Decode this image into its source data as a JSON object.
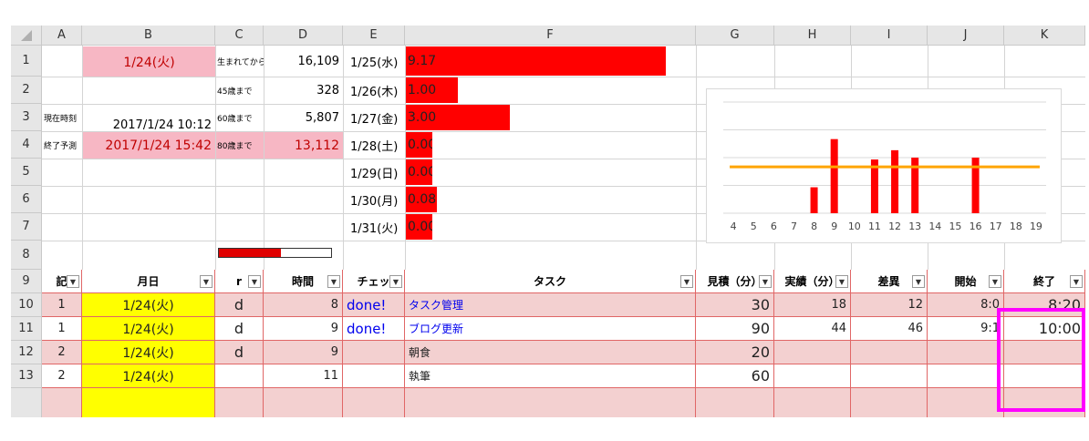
{
  "columns": [
    "A",
    "B",
    "C",
    "D",
    "E",
    "F",
    "G",
    "H",
    "I",
    "J",
    "K"
  ],
  "rows": [
    "1",
    "2",
    "3",
    "4",
    "5",
    "6",
    "7",
    "8",
    "9",
    "10",
    "11",
    "12",
    "13"
  ],
  "top": {
    "b1": "1/24(火)",
    "a3": "現在時刻",
    "b3": "2017/1/24 10:12",
    "a4": "終了予測",
    "b4": "2017/1/24 15:42",
    "c1": "生まれてから",
    "d1": "16,109",
    "c2": "45歳まで",
    "d2": "328",
    "c3": "60歳まで",
    "d3": "5,807",
    "c4": "80歳まで",
    "d4": "13,112",
    "progress": 0.55
  },
  "days": [
    {
      "date": "1/25(水)",
      "value": "9.17",
      "fill": 1.0
    },
    {
      "date": "1/26(木)",
      "value": "1.00",
      "fill": 0.2
    },
    {
      "date": "1/27(金)",
      "value": "3.00",
      "fill": 0.4
    },
    {
      "date": "1/28(土)",
      "value": "0.00",
      "fill": 0.1
    },
    {
      "date": "1/29(日)",
      "value": "0.00",
      "fill": 0.1
    },
    {
      "date": "1/30(月)",
      "value": "0.08",
      "fill": 0.12
    },
    {
      "date": "1/31(火)",
      "value": "0.00",
      "fill": 0.1
    }
  ],
  "table_headers": {
    "a": "記",
    "b": "月日",
    "c": "r",
    "d": "時間",
    "e": "チェッ",
    "f": "タスク",
    "g": "見積（分）",
    "h": "実績（分）",
    "i": "差異",
    "j": "開始",
    "k": "終了"
  },
  "table_rows": [
    {
      "a": "1",
      "b": "1/24(火)",
      "c": "d",
      "d": "8",
      "e": "done!",
      "f": "タスク管理",
      "g": "30",
      "h": "18",
      "i": "12",
      "j": "8:0",
      "k": "8:20"
    },
    {
      "a": "1",
      "b": "1/24(火)",
      "c": "d",
      "d": "9",
      "e": "done!",
      "f": "ブログ更新",
      "g": "90",
      "h": "44",
      "i": "46",
      "j": "9:1",
      "k": "10:00"
    },
    {
      "a": "2",
      "b": "1/24(火)",
      "c": "d",
      "d": "9",
      "e": "",
      "f": "朝食",
      "g": "20",
      "h": "",
      "i": "",
      "j": "",
      "k": ""
    },
    {
      "a": "2",
      "b": "1/24(火)",
      "c": "",
      "d": "11",
      "e": "",
      "f": "執筆",
      "g": "60",
      "h": "",
      "i": "",
      "j": "",
      "k": ""
    }
  ],
  "chart_data": {
    "type": "bar",
    "categories": [
      "4",
      "5",
      "6",
      "7",
      "8",
      "9",
      "10",
      "11",
      "12",
      "13",
      "14",
      "15",
      "16",
      "17",
      "18",
      "19"
    ],
    "values": [
      0,
      0,
      0,
      0,
      1.4,
      4,
      0,
      2.9,
      3.4,
      3,
      0,
      0,
      3,
      0,
      0,
      0
    ],
    "line_value": 2.5,
    "ylim": [
      0,
      6
    ],
    "bar_color": "#ff0000",
    "line_color": "#ffa500",
    "grid": true
  },
  "highlight_color": "#ff00ff"
}
